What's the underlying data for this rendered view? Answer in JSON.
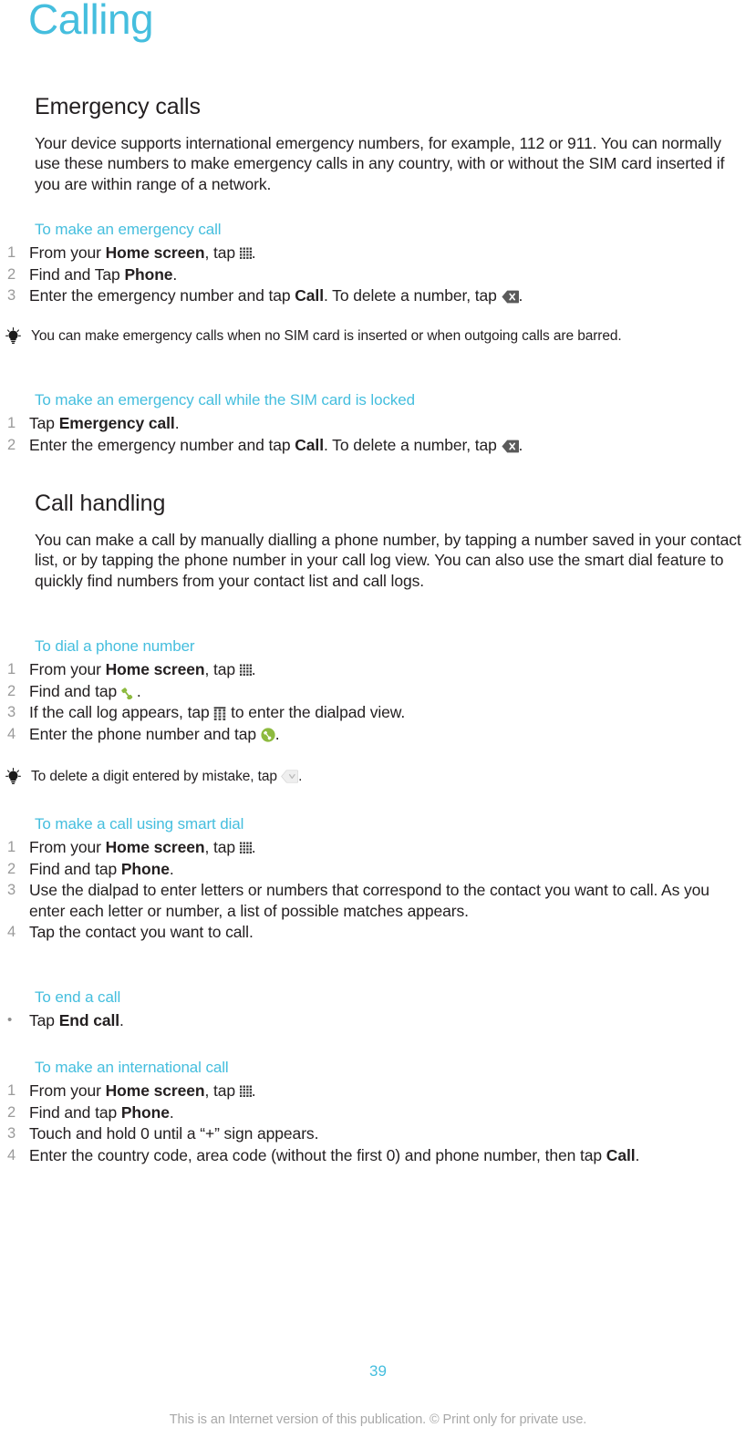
{
  "chapter": {
    "title": "Calling"
  },
  "colors": {
    "accent": "#45bede",
    "body_text": "#231f20",
    "step_number": "#9a9a9a",
    "footer_note": "#a8a8a8"
  },
  "sections": [
    {
      "heading": "Emergency calls",
      "intro": "Your device supports international emergency numbers, for example, 112 or 911. You can normally use these numbers to make emergency calls in any country, with or without the SIM card inserted if you are within range of a network."
    },
    {
      "heading": "Call handling",
      "intro": "You can make a call by manually dialling a phone number, by tapping a number saved in your contact list, or by tapping the phone number in your call log view. You can also use the smart dial feature to quickly find numbers from your contact list and call logs."
    }
  ],
  "procedures": {
    "emergency_call": {
      "heading": "To make an emergency call",
      "steps": [
        {
          "num": "1",
          "pre": "From your ",
          "bold": "Home screen",
          "post": ", tap ",
          "icon": "app-drawer-icon",
          "tail": "."
        },
        {
          "num": "2",
          "pre": "Find and Tap ",
          "bold": "Phone",
          "post": ".",
          "icon": "",
          "tail": ""
        },
        {
          "num": "3",
          "pre": "Enter the emergency number and tap ",
          "bold": "Call",
          "post": ". To delete a number, tap ",
          "icon": "backspace-dark-icon",
          "tail": "."
        }
      ],
      "tip": "You can make emergency calls when no SIM card is inserted or when outgoing calls are barred."
    },
    "emergency_call_sim_locked": {
      "heading": "To make an emergency call while the SIM card is locked",
      "steps": [
        {
          "num": "1",
          "pre": "Tap ",
          "bold": "Emergency call",
          "post": ".",
          "icon": "",
          "tail": ""
        },
        {
          "num": "2",
          "pre": "Enter the emergency number and tap ",
          "bold": "Call",
          "post": ". To delete a number, tap ",
          "icon": "backspace-dark-icon",
          "tail": "."
        }
      ]
    },
    "dial_phone_number": {
      "heading": "To dial a phone number",
      "steps": [
        {
          "num": "1",
          "pre": "From your ",
          "bold": "Home screen",
          "post": ", tap ",
          "icon": "app-drawer-icon",
          "tail": "."
        },
        {
          "num": "2",
          "pre": "Find and tap ",
          "bold": "",
          "post": "",
          "icon": "handset-icon",
          "tail": "."
        },
        {
          "num": "3",
          "pre": "If the call log appears, tap ",
          "bold": "",
          "post": "",
          "icon": "dialpad-icon",
          "tail": " to enter the dialpad view."
        },
        {
          "num": "4",
          "pre": "Enter the phone number and tap ",
          "bold": "",
          "post": "",
          "icon": "call-button-icon",
          "tail": "."
        }
      ],
      "tip_pre": "To delete a digit entered by mistake, tap ",
      "tip_icon": "backspace-light-icon",
      "tip_tail": "."
    },
    "smart_dial": {
      "heading": "To make a call using smart dial",
      "steps": [
        {
          "num": "1",
          "pre": "From your ",
          "bold": "Home screen",
          "post": ", tap ",
          "icon": "app-drawer-icon",
          "tail": "."
        },
        {
          "num": "2",
          "pre": "Find and tap ",
          "bold": "Phone",
          "post": ".",
          "icon": "",
          "tail": ""
        },
        {
          "num": "3",
          "pre": "Use the dialpad to enter letters or numbers that correspond to the contact you want to call. As you enter each letter or number, a list of possible matches appears.",
          "bold": "",
          "post": "",
          "icon": "",
          "tail": ""
        },
        {
          "num": "4",
          "pre": "Tap the contact you want to call.",
          "bold": "",
          "post": "",
          "icon": "",
          "tail": ""
        }
      ]
    },
    "end_call": {
      "heading": "To end a call",
      "bullet": "•",
      "steps": [
        {
          "num": "•",
          "pre": "Tap ",
          "bold": "End call",
          "post": ".",
          "icon": "",
          "tail": ""
        }
      ]
    },
    "international_call": {
      "heading": "To make an international call",
      "steps": [
        {
          "num": "1",
          "pre": "From your ",
          "bold": "Home screen",
          "post": ", tap ",
          "icon": "app-drawer-icon",
          "tail": "."
        },
        {
          "num": "2",
          "pre": "Find and tap ",
          "bold": "Phone",
          "post": ".",
          "icon": "",
          "tail": ""
        },
        {
          "num": "3",
          "pre": "Touch and hold 0 until a “+” sign appears.",
          "bold": "",
          "post": "",
          "icon": "",
          "tail": ""
        },
        {
          "num": "4",
          "pre": "Enter the country code, area code (without the first 0) and phone number, then tap ",
          "bold": "Call",
          "post": ".",
          "icon": "",
          "tail": ""
        }
      ]
    }
  },
  "footer": {
    "page_number": "39",
    "note": "This is an Internet version of this publication. © Print only for private use."
  }
}
